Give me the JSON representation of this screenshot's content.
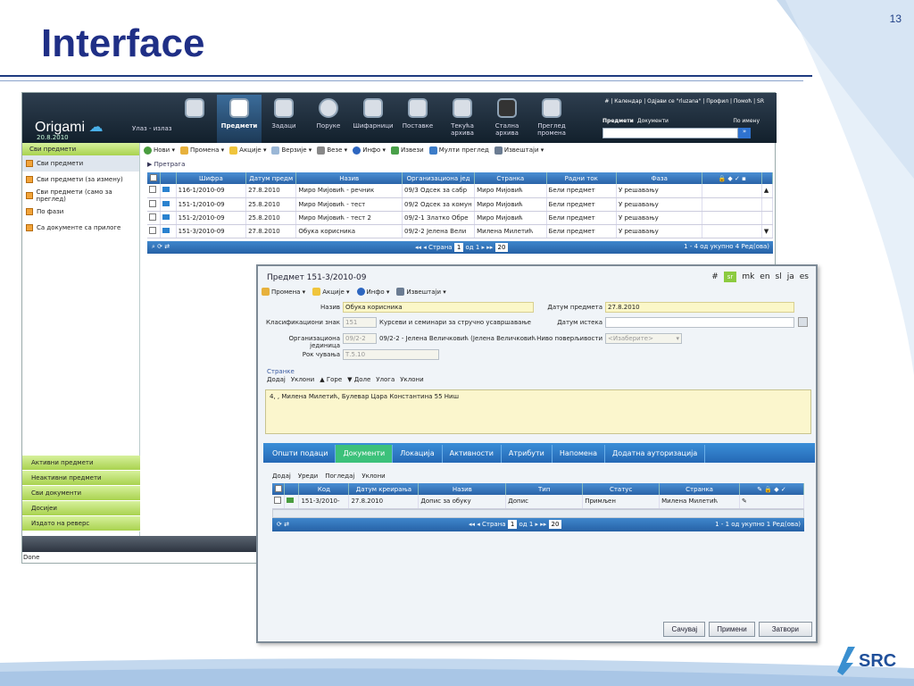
{
  "slide": {
    "title": "Interface",
    "number": "13"
  },
  "app": {
    "logo": "Origami",
    "logo_date": "20.8.2010",
    "exit_link": "Улаз - излаз",
    "modules": [
      "Предмети",
      "Задаци",
      "Поруке",
      "Шифарници",
      "Поставке",
      "Текућа архива",
      "Стална архива",
      "Преглед промена"
    ],
    "active_module": "Предмети",
    "top_links": "# | Календар | Одјави се \"rluzana\" | Профил | Помоћ | SR",
    "search": {
      "tab1": "Предмети",
      "tab2": "Документи",
      "by": "По имену",
      "go": "»"
    },
    "sidebar": {
      "header": "Сви предмети",
      "items": [
        "Сви предмети",
        "Сви предмети (за измену)",
        "Сви предмети (само за преглед)",
        "По фази",
        "Са документе са прилоге"
      ],
      "bottom": [
        "Активни предмети",
        "Неактивни предмети",
        "Сви документи",
        "Досијеи",
        "Издато на реверс"
      ]
    },
    "toolbar": [
      "Нови ▾",
      "Промена ▾",
      "Акције ▾",
      "Верзије ▾",
      "Везе ▾",
      "Инфо ▾",
      "Извези",
      "Мулти преглед",
      "Извештаји ▾"
    ],
    "search_label": "▶ Претрага",
    "grid": {
      "columns": [
        "Шифра",
        "Датум предм",
        "Назив",
        "Организациона јед",
        "Странка",
        "Радни ток",
        "Фаза"
      ],
      "rows": [
        [
          "116-1/2010-09",
          "27.8.2010",
          "Миро Мијовић - речник",
          "09/3 Одсек за сабр",
          "Миро Мијовић",
          "Бели предмет",
          "У решавању"
        ],
        [
          "151-1/2010-09",
          "25.8.2010",
          "Миро Мијовић - тест",
          "09/2 Одсек за комун",
          "Миро Мијовић",
          "Бели предмет",
          "У решавању"
        ],
        [
          "151-2/2010-09",
          "25.8.2010",
          "Миро Мијовић - тест 2",
          "09/2-1 Златко Обре",
          "Миро Мијовић",
          "Бели предмет",
          "У решавању"
        ],
        [
          "151-3/2010-09",
          "27.8.2010",
          "Обука корисника",
          "09/2-2 Јелена Вели",
          "Милена Милетић",
          "Бели предмет",
          "У решавању"
        ]
      ],
      "pager": {
        "page_label": "Страна",
        "page": "1",
        "of": "од 1",
        "size": "20",
        "summary": "1 - 4 од укупно 4 Ред(ова)"
      }
    },
    "status": "Done"
  },
  "dialog": {
    "title": "Предмет 151-3/2010-09",
    "langs": [
      "#",
      "sr",
      "mk",
      "en",
      "sl",
      "ja",
      "es"
    ],
    "toolbar": [
      "Промена ▾",
      "Акције ▾",
      "Инфо ▾",
      "Извештаји ▾"
    ],
    "fields": {
      "naziv_label": "Назив",
      "naziv": "Обука корисника",
      "datum_label": "Датум предмета",
      "datum": "27.8.2010",
      "klas_label": "Класификациони знак",
      "klas_code": "151",
      "klas_text": "Курсеви и семинари за стручно усавршавање",
      "istek_label": "Датум истека",
      "istek": "",
      "org_label": "Организациона јединица",
      "org_code": "09/2-2",
      "org_text": "09/2-2 - Јелена Величковић (Јелена Величковић",
      "niv_label": "Ниво поверљивости",
      "niv": "<Изаберите>",
      "rok_label": "Рок чувања",
      "rok": "Т.5.10"
    },
    "stranke": {
      "legend": "Странке",
      "toolbar": [
        "Додај",
        "Уклони",
        "▲ Горе",
        "▼ Доле",
        "Улога",
        "Уклони"
      ],
      "text": "4, , Милена Милетић, Булевар Цара Константина 55 Ниш"
    },
    "tabs": [
      "Општи подаци",
      "Документи",
      "Локација",
      "Активности",
      "Атрибути",
      "Напомена",
      "Додатна ауторизација"
    ],
    "active_tab": "Документи",
    "docs": {
      "toolbar": [
        "Додај",
        "Уреди",
        "Погледај",
        "Уклони"
      ],
      "columns": [
        "Код",
        "Датум креирања",
        "Назив",
        "Тип",
        "Статус",
        "Странка"
      ],
      "rows": [
        [
          "151-3/2010-",
          "27.8.2010",
          "Допис за обуку",
          "Допис",
          "Примљен",
          "Милена Милетић"
        ]
      ],
      "pager": {
        "page_label": "Страна",
        "page": "1",
        "of": "од 1",
        "size": "20",
        "summary": "1 - 1 од укупно 1 Ред(ова)"
      }
    },
    "buttons": [
      "Сачувај",
      "Примени",
      "Затвори"
    ]
  },
  "brand": "SRC",
  "colors": {
    "title": "#1f2f86",
    "grid_header": "#2a63a8",
    "sidebar": "#a9d24f",
    "active_tab": "#3cc17a"
  }
}
